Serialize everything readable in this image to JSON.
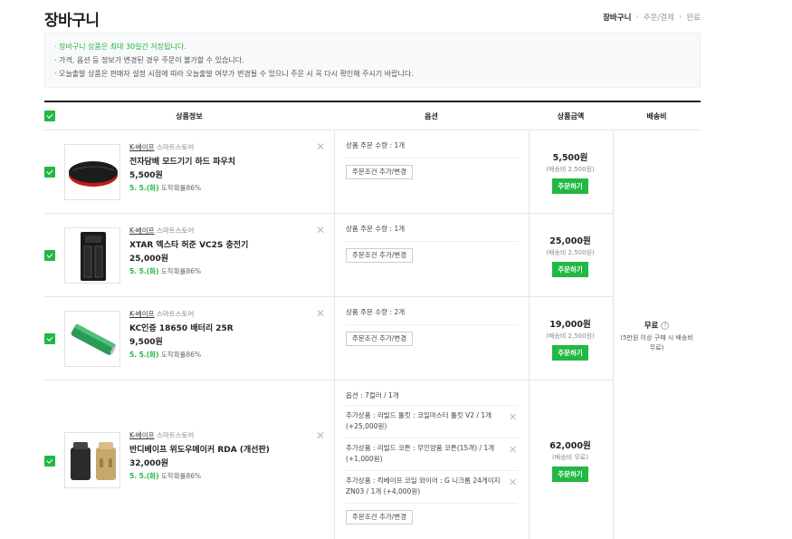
{
  "page": {
    "title": "장바구니",
    "breadcrumb": [
      "장바구니",
      "주문/결제",
      "완료"
    ]
  },
  "notice": [
    "· 장바구니 상품은 최대 30일간 저장됩니다.",
    "· 가격, 옵션 등 정보가 변경된 경우 주문이 불가할 수 있습니다.",
    "· 오늘출발 상품은 판매자 설정 시점에 따라 오늘출발 여부가 변경될 수 있으니 주문 시 꼭 다시 확인해 주시기 바랍니다."
  ],
  "columns": {
    "product": "상품정보",
    "option": "옵션",
    "price": "상품금액",
    "shipping": "배송비"
  },
  "seller_suffix": "스마트스토어",
  "items": [
    {
      "seller": "K-베이프",
      "name": "전자담배 모드기기 하드 파우치",
      "price": "5,500원",
      "delivery_date": "5. 5.(화)",
      "delivery_rate": "도착확률86%",
      "options": [
        "상품 주문 수량 : 1개"
      ],
      "option_button": "주문조건 추가/변경",
      "total": "5,500원",
      "shipping_sub": "(배송비 2,500원)",
      "order_button": "주문하기"
    },
    {
      "seller": "K-베이프",
      "name": "XTAR 엑스타 허준 VC2S 충전기",
      "price": "25,000원",
      "delivery_date": "5. 5.(화)",
      "delivery_rate": "도착확률86%",
      "options": [
        "상품 주문 수량 : 1개"
      ],
      "option_button": "주문조건 추가/변경",
      "total": "25,000원",
      "shipping_sub": "(배송비 2,500원)",
      "order_button": "주문하기"
    },
    {
      "seller": "K-베이프",
      "name": "KC인증 18650 배터리 25R",
      "price": "9,500원",
      "delivery_date": "5. 5.(화)",
      "delivery_rate": "도착확률86%",
      "options": [
        "상품 주문 수량 : 2개"
      ],
      "option_button": "주문조건 추가/변경",
      "total": "19,000원",
      "shipping_sub": "(배송비 2,500원)",
      "order_button": "주문하기"
    },
    {
      "seller": "K-베이프",
      "name": "반디베이프 위도우메이커 RDA (개선판)",
      "price": "32,000원",
      "delivery_date": "5. 5.(화)",
      "delivery_rate": "도착확률86%",
      "options": [
        "옵션 : 7컬러 / 1개",
        "추가상품 : 리빌드 툴킷 : 코일마스터 툴킷 V2 / 1개 (+25,000원)",
        "추가상품 : 리빌드 코튼 : 무인양품 코튼(15개) / 1개 (+1,000원)",
        "추가상품 : 킥베이프 코일 와이어 : G 니크롬 24게이지 ZN03 / 1개 (+4,000원)"
      ],
      "option_button": "주문조건 추가/변경",
      "total": "62,000원",
      "shipping_sub": "(배송비 무료)",
      "order_button": "주문하기"
    }
  ],
  "shipping": {
    "label": "무료",
    "help_icon": "?",
    "note": "(5만원 이상 구매 시 배송비 무료)"
  },
  "colors": {
    "accent": "#21b844",
    "border": "#e5e5e5",
    "notice_bg": "#f8f9fa"
  }
}
